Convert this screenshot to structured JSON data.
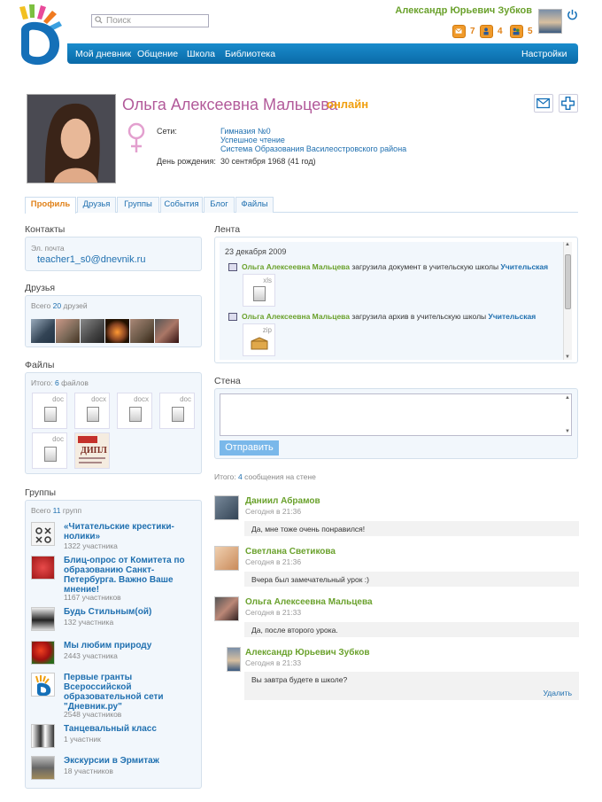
{
  "header": {
    "search_placeholder": "Поиск",
    "user_name": "Александр Юрьевич Зубков",
    "notifications": [
      {
        "icon": "mail-icon",
        "count": "7"
      },
      {
        "icon": "people-icon",
        "count": "4"
      },
      {
        "icon": "group-icon",
        "count": "5"
      }
    ]
  },
  "nav": {
    "items": [
      "Мой дневник",
      "Общение",
      "Школа",
      "Библиотека"
    ],
    "settings": "Настройки"
  },
  "profile": {
    "name": "Ольга Алексеевна Мальцева",
    "status": "онлайн",
    "networks_label": "Сети:",
    "networks": [
      "Гимназия №0",
      "Успешное чтение",
      "Система Образования Василеостровского района"
    ],
    "birthday_label": "День рождения:",
    "birthday": "30 сентября 1968 (41 год)"
  },
  "tabs": [
    "Профиль",
    "Друзья",
    "Группы",
    "События",
    "Блог",
    "Файлы"
  ],
  "contacts": {
    "title": "Контакты",
    "email_label": "Эл. почта",
    "email": "teacher1_s0@dnevnik.ru"
  },
  "friends": {
    "title": "Друзья",
    "total_prefix": "Всего",
    "count": "20",
    "total_suffix": "друзей"
  },
  "files": {
    "title": "Файлы",
    "total_prefix": "Итого:",
    "count": "6",
    "total_suffix": "файлов",
    "items": [
      "doc",
      "docx",
      "docx",
      "doc",
      "doc"
    ],
    "image_text": "ДИПЛ"
  },
  "groups": {
    "title": "Группы",
    "total_prefix": "Всего",
    "count": "11",
    "total_suffix": "групп",
    "items": [
      {
        "name": "«Читательские крестики-нолики»",
        "members": "1322 участника"
      },
      {
        "name": "Блиц-опрос от Комитета по образованию Санкт-Петербурга. Важно Ваше мнение!",
        "members": "1167 участников"
      },
      {
        "name": "Будь Стильным(ой)",
        "members": "132 участника"
      },
      {
        "name": "Мы любим природу",
        "members": "2443 участника"
      },
      {
        "name": "Первые гранты Всероссийской образовательной сети \"Дневник.ру\"",
        "members": "2548 участников"
      },
      {
        "name": "Танцевальный класс",
        "members": "1 участник"
      },
      {
        "name": "Экскурсии в Эрмитаж",
        "members": "18 участников"
      }
    ]
  },
  "feed": {
    "title": "Лента",
    "date": "23 декабря 2009",
    "items": [
      {
        "author": "Ольга Алексеевна Мальцева",
        "action": "загрузила документ в учительскую школы",
        "target": "Учительская",
        "ext": "xls"
      },
      {
        "author": "Ольга Алексеевна Мальцева",
        "action": "загрузила архив в учительскую школы",
        "target": "Учительская",
        "ext": "zip"
      }
    ]
  },
  "wall": {
    "title": "Стена",
    "send": "Отправить",
    "total_prefix": "Итого:",
    "count": "4",
    "total_suffix": "сообщения на стене",
    "delete": "Удалить",
    "messages": [
      {
        "author": "Даниил Абрамов",
        "time": "Сегодня в 21:36",
        "text": "Да, мне тоже очень понравился!"
      },
      {
        "author": "Светлана Светикова",
        "time": "Сегодня в 21:36",
        "text": "Вчера был замечательный урок :)"
      },
      {
        "author": "Ольга Алексеевна Мальцева",
        "time": "Сегодня в 21:33",
        "text": "Да, после второго урока."
      },
      {
        "author": "Александр Юрьевич Зубков",
        "time": "Сегодня в 21:33",
        "text": "Вы завтра будете в школе?"
      }
    ]
  },
  "colors": {
    "brand_blue": "#0a78bc",
    "accent_green": "#6aa12c",
    "accent_orange": "#f0a010",
    "name_purple": "#b25a9a"
  }
}
